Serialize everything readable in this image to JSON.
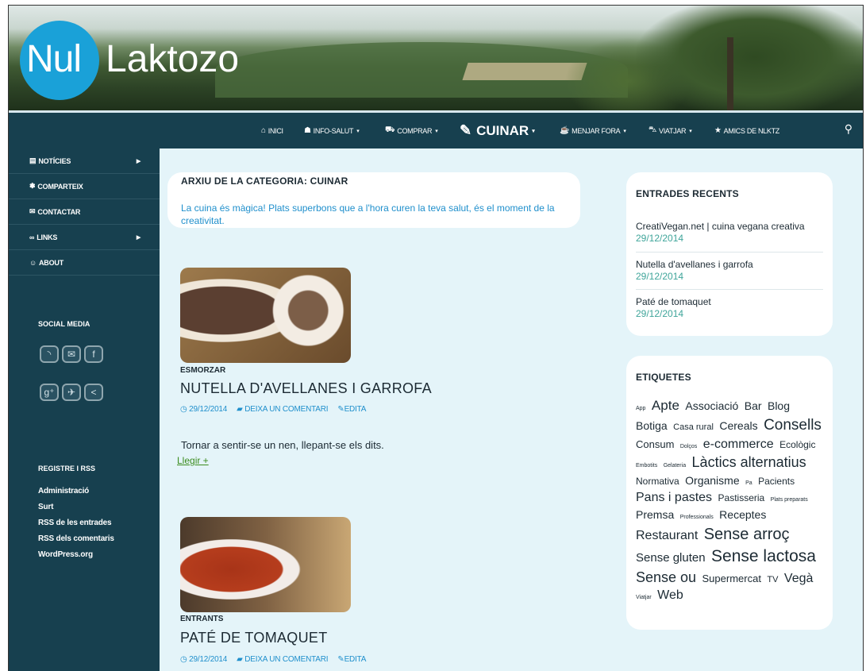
{
  "site": {
    "logo_nul": "Nul",
    "logo_laktozo": "Laktozo"
  },
  "nav": {
    "items": [
      {
        "label": "INICI",
        "icon": "home-icon"
      },
      {
        "label": "INFO-SALUT",
        "icon": "doctor-icon"
      },
      {
        "label": "COMPRAR",
        "icon": "cart-icon"
      },
      {
        "label": "CUINAR",
        "icon": "carrot-icon"
      },
      {
        "label": "MENJAR FORA",
        "icon": "dish-icon"
      },
      {
        "label": "VIATJAR",
        "icon": "car-icon"
      },
      {
        "label": "AMICS DE NLKTZ",
        "icon": "star-icon"
      }
    ]
  },
  "sidebar": {
    "menu": [
      {
        "label": "NOTÍCIES",
        "icon": "newspaper-icon"
      },
      {
        "label": "COMPARTEIX",
        "icon": "share-icon"
      },
      {
        "label": "CONTACTAR",
        "icon": "mail-icon"
      },
      {
        "label": "LINKS",
        "icon": "link-icon"
      },
      {
        "label": "ABOUT",
        "icon": "smile-icon"
      }
    ],
    "social_heading": "SOCIAL MEDIA",
    "rss_heading": "REGISTRE I RSS",
    "meta_links": [
      "Administració",
      "Surt",
      "RSS de les entrades",
      "RSS dels comentaris",
      "WordPress.org"
    ]
  },
  "archive": {
    "title": "ARXIU DE LA CATEGORIA: CUINAR",
    "description": "La cuina és màgica! Plats superbons que a l'hora curen la teva salut, és el moment de la creativitat."
  },
  "posts": [
    {
      "category": "ESMORZAR",
      "title": "NUTELLA D'AVELLANES I GARROFA",
      "date": "29/12/2014",
      "comment": "DEIXA UN COMENTARI",
      "edit": "EDITA",
      "excerpt": "Tornar a sentir-se un nen, llepant-se els dits.",
      "readmore": "Llegir +"
    },
    {
      "category": "ENTRANTS",
      "title": "PATÉ DE TOMAQUET",
      "date": "29/12/2014",
      "comment": "DEIXA UN COMENTARI",
      "edit": "EDITA"
    }
  ],
  "recent": {
    "heading": "ENTRADES RECENTS",
    "items": [
      {
        "title": "CreatiVegan.net | cuina vegana creativa",
        "date": "29/12/2014"
      },
      {
        "title": "Nutella d'avellanes i garrofa",
        "date": "29/12/2014"
      },
      {
        "title": "Paté de tomaquet",
        "date": "29/12/2014"
      }
    ]
  },
  "tags": {
    "heading": "ETIQUETES",
    "items": [
      {
        "label": "App",
        "size": 7
      },
      {
        "label": "Apte",
        "size": 17
      },
      {
        "label": "Associació",
        "size": 14
      },
      {
        "label": "Bar",
        "size": 14
      },
      {
        "label": "Blog",
        "size": 14
      },
      {
        "label": "Botiga",
        "size": 14
      },
      {
        "label": "Casa rural",
        "size": 11
      },
      {
        "label": "Cereals",
        "size": 14
      },
      {
        "label": "Consells",
        "size": 19
      },
      {
        "label": "Consum",
        "size": 13
      },
      {
        "label": "Dolços",
        "size": 7
      },
      {
        "label": "e-commerce",
        "size": 16
      },
      {
        "label": "Ecològic",
        "size": 12
      },
      {
        "label": "Embotits",
        "size": 7
      },
      {
        "label": "Gelateria",
        "size": 7
      },
      {
        "label": "Làctics alternatius",
        "size": 18
      },
      {
        "label": "Normativa",
        "size": 12
      },
      {
        "label": "Organisme",
        "size": 14
      },
      {
        "label": "Pa",
        "size": 7
      },
      {
        "label": "Pacients",
        "size": 12
      },
      {
        "label": "Pans i pastes",
        "size": 16
      },
      {
        "label": "Pastisseria",
        "size": 12
      },
      {
        "label": "Plats preparats",
        "size": 7
      },
      {
        "label": "Premsa",
        "size": 14
      },
      {
        "label": "Professionals",
        "size": 7
      },
      {
        "label": "Receptes",
        "size": 14
      },
      {
        "label": "Restaurant",
        "size": 16
      },
      {
        "label": "Sense arroç",
        "size": 20
      },
      {
        "label": "Sense gluten",
        "size": 15
      },
      {
        "label": "Sense lactosa",
        "size": 21
      },
      {
        "label": "Sense ou",
        "size": 18
      },
      {
        "label": "Supermercat",
        "size": 13
      },
      {
        "label": "TV",
        "size": 11
      },
      {
        "label": "Vegà",
        "size": 16
      },
      {
        "label": "Viatjar",
        "size": 7
      },
      {
        "label": "Web",
        "size": 16
      }
    ]
  }
}
